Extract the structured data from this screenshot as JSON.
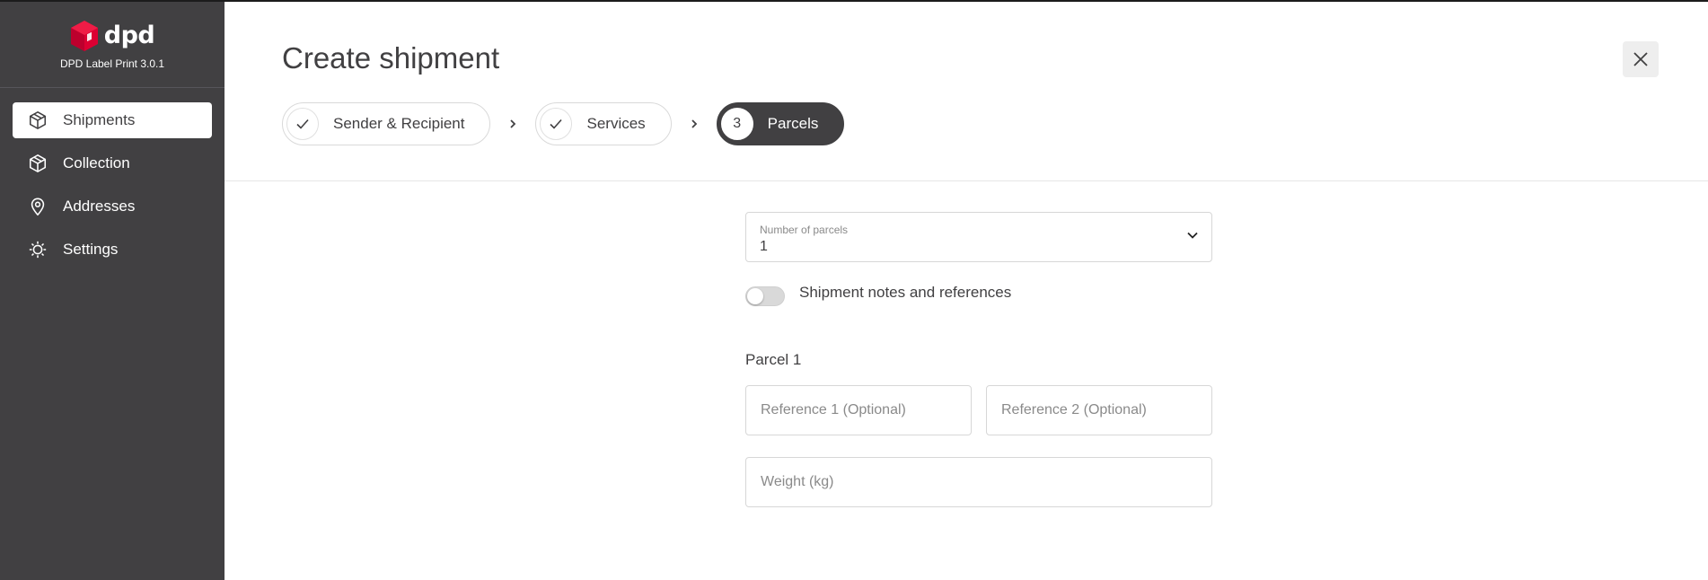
{
  "app": {
    "brand_name": "dpd",
    "version_label": "DPD Label Print 3.0.1"
  },
  "sidebar": {
    "items": [
      {
        "label": "Shipments",
        "icon": "box-icon",
        "active": true
      },
      {
        "label": "Collection",
        "icon": "box-icon",
        "active": false
      },
      {
        "label": "Addresses",
        "icon": "map-pin-icon",
        "active": false
      },
      {
        "label": "Settings",
        "icon": "gear-icon",
        "active": false
      }
    ]
  },
  "header": {
    "title": "Create shipment",
    "steps": [
      {
        "label": "Sender & Recipient",
        "state": "done"
      },
      {
        "label": "Services",
        "state": "done"
      },
      {
        "label": "Parcels",
        "state": "active",
        "number": "3"
      }
    ]
  },
  "form": {
    "parcels_select": {
      "label": "Number of parcels",
      "value": "1"
    },
    "notes_toggle": {
      "label": "Shipment notes and references",
      "on": false
    },
    "parcel_title": "Parcel 1",
    "reference1_placeholder": "Reference 1 (Optional)",
    "reference2_placeholder": "Reference 2 (Optional)",
    "weight_placeholder": "Weight (kg)"
  },
  "colors": {
    "sidebar_bg": "#414042",
    "brand_red": "#dc0032",
    "text": "#414042",
    "border": "#d7d7d7"
  }
}
